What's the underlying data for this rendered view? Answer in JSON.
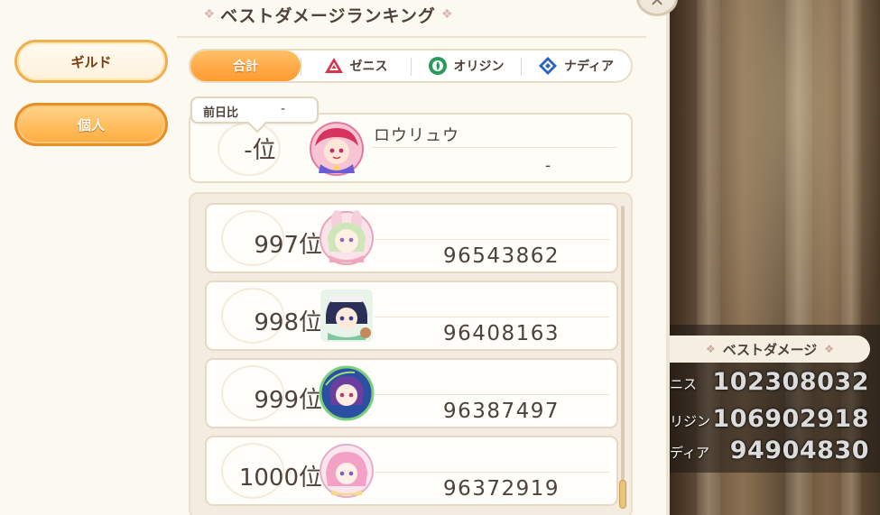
{
  "title": "ベストダメージランキング",
  "close_label": "✕",
  "modes": {
    "guild": "ギルド",
    "personal": "個人"
  },
  "tabs": [
    {
      "label": "合計",
      "icon": "sum"
    },
    {
      "label": "ゼニス",
      "icon": "zenith-icon"
    },
    {
      "label": "オリジン",
      "icon": "origin-icon"
    },
    {
      "label": "ナディア",
      "icon": "nadia-icon"
    }
  ],
  "my_entry": {
    "prev_day_label": "前日比",
    "prev_day_value": "-",
    "rank": "-位",
    "name": "ロウリュウ",
    "score": "-"
  },
  "ranking": [
    {
      "rank": "997位",
      "score": "96543862",
      "avatar": "bunny-ears-girl-avatar"
    },
    {
      "rank": "998位",
      "score": "96408163",
      "avatar": "dark-haired-boy-avatar"
    },
    {
      "rank": "999位",
      "score": "96387497",
      "avatar": "purple-haired-girl-avatar"
    },
    {
      "rank": "1000位",
      "score": "96372919",
      "avatar": "pink-haired-girl-avatar"
    }
  ],
  "best_damage": {
    "title": "ベストダメージ",
    "rows": [
      {
        "label": "ニス",
        "value": "102308032"
      },
      {
        "label": "リジン",
        "value": "106902918"
      },
      {
        "label": "ディア",
        "value": "94904830"
      }
    ]
  },
  "colors": {
    "accent_orange": "#ff9a2e",
    "panel_cream": "#fcf9f1",
    "text_brown": "#4f423a"
  }
}
